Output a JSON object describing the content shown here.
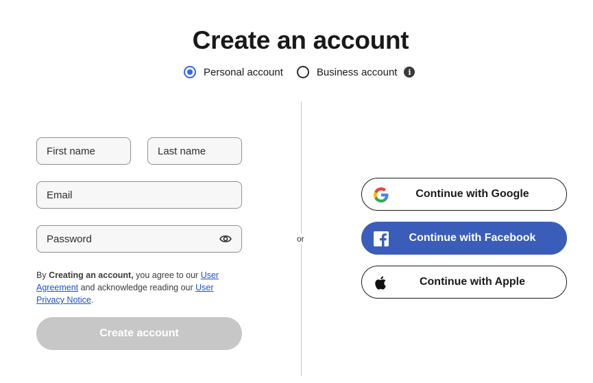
{
  "page": {
    "title": "Create an account"
  },
  "account_type": {
    "options": [
      {
        "label": "Personal account",
        "selected": true
      },
      {
        "label": "Business account",
        "selected": false
      }
    ],
    "info_icon": "info-icon"
  },
  "form": {
    "first_name_placeholder": "First name",
    "last_name_placeholder": "Last name",
    "email_placeholder": "Email",
    "password_placeholder": "Password",
    "password_toggle_icon": "eye-icon"
  },
  "legal": {
    "prefix": "By ",
    "bold": "Creating an account,",
    "middle1": " you agree to our ",
    "link1": "User Agreement",
    "middle2": " and acknowledge reading our ",
    "link2": "User Privacy Notice",
    "suffix": "."
  },
  "create_button": {
    "label": "Create account",
    "color": "#c7c7c7"
  },
  "divider": {
    "label": "or"
  },
  "social": {
    "google_label": "Continue with Google",
    "facebook_label": "Continue with Facebook",
    "apple_label": "Continue with Apple",
    "facebook_color": "#3b5dba",
    "accent_color": "#3665f3"
  }
}
